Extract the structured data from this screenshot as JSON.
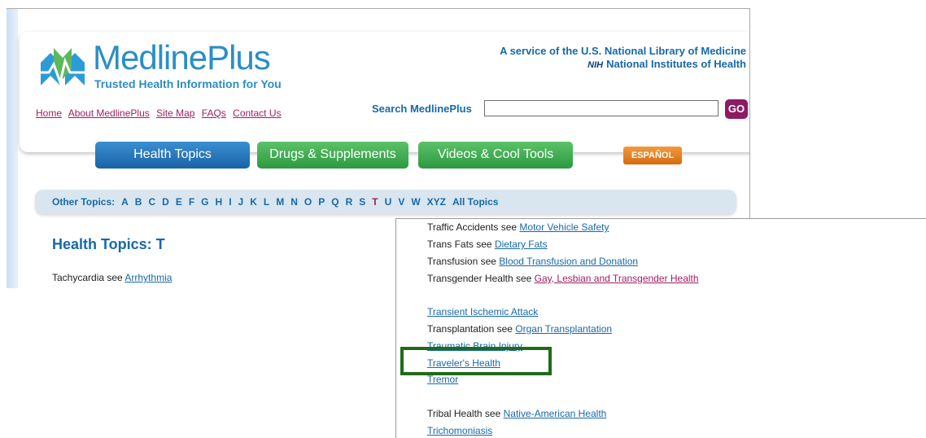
{
  "colors": {
    "accent_blue": "#1769a8",
    "visited_magenta": "#9e1f63",
    "highlight_green": "#1f6b19",
    "tab_blue": "#1a62a8",
    "tab_green": "#2c9a3f",
    "espanol_orange": "#d86a10"
  },
  "logo": {
    "name": "MedlinePlus",
    "tagline": "Trusted Health Information for You",
    "icon": "medlineplus-logo-icon"
  },
  "service": {
    "line1": "A service of the U.S. National Library of Medicine",
    "nih_abbr": "NIH",
    "line2": "National Institutes of Health"
  },
  "top_links": [
    "Home",
    "About MedlinePlus",
    "Site Map",
    "FAQs",
    "Contact Us"
  ],
  "search": {
    "label": "Search MedlinePlus",
    "value": "",
    "go_label": "GO"
  },
  "tabs": [
    "Health Topics",
    "Drugs & Supplements",
    "Videos & Cool Tools"
  ],
  "espanol": "ESPAÑOL",
  "letter_bar": {
    "label": "Other Topics:",
    "letters": [
      "A",
      "B",
      "C",
      "D",
      "E",
      "F",
      "G",
      "H",
      "I",
      "J",
      "K",
      "L",
      "M",
      "N",
      "O",
      "P",
      "Q",
      "R",
      "S",
      "T",
      "U",
      "V",
      "W",
      "XYZ"
    ],
    "current": "T",
    "all_topics": "All Topics"
  },
  "heading": "Health Topics: T",
  "first_entry": {
    "prefix": "Tachycardia see",
    "link": "Arrhythmia"
  },
  "zoom_entries": [
    {
      "prefix": "Traffic Accidents see",
      "link": "Motor Vehicle Safety"
    },
    {
      "prefix": "Trans Fats see",
      "link": "Dietary Fats"
    },
    {
      "prefix": "Transfusion see",
      "link": "Blood Transfusion and Donation"
    },
    {
      "prefix": "Transgender Health see",
      "link": "Gay, Lesbian and Transgender Health"
    },
    {
      "prefix": "",
      "link": "Transient Ischemic Attack"
    },
    {
      "prefix": "Transplantation see",
      "link": "Organ Transplantation"
    },
    {
      "prefix": "",
      "link": "Traumatic Brain Injury"
    },
    {
      "prefix": "",
      "link": "Traveler's Health"
    },
    {
      "prefix": "",
      "link": "Tremor"
    },
    {
      "prefix": "Tribal Health see",
      "link": "Native-American Health"
    },
    {
      "prefix": "",
      "link": "Trichomoniasis"
    }
  ],
  "highlighted_entry": "Traveler's Health"
}
